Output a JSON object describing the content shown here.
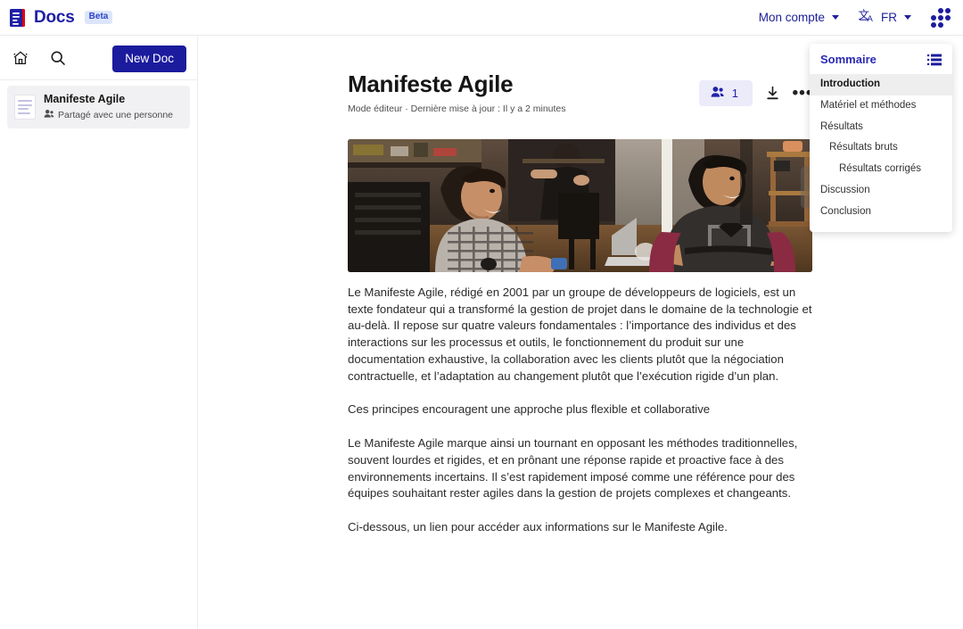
{
  "app": {
    "brand": "Docs",
    "badge": "Beta",
    "logo_icon": "document-lines-icon"
  },
  "topbar": {
    "account_label": "Mon compte",
    "account_caret_icon": "chevron-down-icon",
    "language_icon": "translate-icon",
    "language_code": "FR",
    "language_caret_icon": "chevron-down-icon",
    "apps_icon": "apps-grid-icon"
  },
  "sidebar": {
    "home_icon": "home-icon",
    "search_icon": "search-icon",
    "new_doc_label": "New Doc",
    "documents": [
      {
        "title": "Manifeste Agile",
        "shared_icon": "people-icon",
        "shared_label": "Partagé avec une personne",
        "thumb_icon": "document-icon",
        "selected": true
      }
    ]
  },
  "document": {
    "title": "Manifeste Agile",
    "subline": "Mode éditeur · Dernière mise à jour : Il y a 2 minutes",
    "share_icon": "people-icon",
    "share_count": "1",
    "download_icon": "download-icon",
    "more_icon": "ellipsis-icon",
    "figure_alt": "Deux personnes souriantes assises dans un espace de coworking",
    "paragraphs": [
      "Le Manifeste Agile, rédigé en 2001 par un groupe de développeurs de logiciels, est un texte fondateur qui a transformé la gestion de projet dans le domaine de la technologie et au-delà. Il repose sur quatre valeurs fondamentales : l’importance des individus et des interactions sur les processus et outils, le fonctionnement du produit sur une documentation exhaustive, la collaboration avec les clients plutôt que la négociation contractuelle, et l’adaptation au changement plutôt que l’exécution rigide d’un plan.",
      "Ces principes encouragent une approche plus flexible et collaborative",
      "Le Manifeste Agile marque ainsi un tournant en opposant les méthodes traditionnelles, souvent lourdes et rigides, et en prônant une réponse rapide et proactive face à des environnements incertains. Il s’est rapidement imposé comme une référence pour des équipes souhaitant rester agiles dans la gestion de projets complexes et changeants.",
      "Ci-dessous, un lien pour accéder aux informations sur le Manifeste Agile."
    ]
  },
  "toc": {
    "title": "Sommaire",
    "list_icon": "list-bullet-icon",
    "items": [
      {
        "label": "Introduction",
        "level": 1,
        "active": true
      },
      {
        "label": "Matériel et méthodes",
        "level": 1,
        "active": false
      },
      {
        "label": "Résultats",
        "level": 1,
        "active": false
      },
      {
        "label": "Résultats bruts",
        "level": 2,
        "active": false
      },
      {
        "label": "Résultats corrigés",
        "level": 3,
        "active": false
      },
      {
        "label": "Discussion",
        "level": 1,
        "active": false
      },
      {
        "label": "Conclusion",
        "level": 1,
        "active": false
      }
    ]
  },
  "colors": {
    "brand_blue": "#1f1fa5",
    "action_blue": "#1b1b9e",
    "badge_bg": "#dde5fb",
    "share_pill_bg": "#ebebfa",
    "selected_row_bg": "#f1f1f3",
    "toc_active_bg": "#eeeeee",
    "logo_accent_red": "#e1000f"
  }
}
